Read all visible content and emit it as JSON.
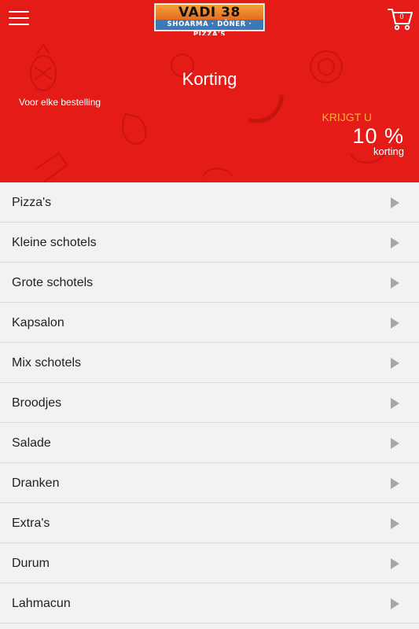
{
  "header": {
    "menu_icon": "hamburger-menu-icon",
    "logo": {
      "name": "VADI 38",
      "subtitle": "SHOARMA · DÖNER · PIZZA'S"
    },
    "cart_icon": "shopping-cart-icon",
    "cart_count": "0"
  },
  "banner": {
    "title": "Korting",
    "subtitle": "Voor elke bestelling",
    "krijgt": "KRIJGT U",
    "percentage": "10 %",
    "korting": "korting"
  },
  "menu": {
    "items": [
      {
        "label": "Pizza's"
      },
      {
        "label": "Kleine schotels"
      },
      {
        "label": "Grote schotels"
      },
      {
        "label": "Kapsalon"
      },
      {
        "label": "Mix schotels"
      },
      {
        "label": "Broodjes"
      },
      {
        "label": "Salade"
      },
      {
        "label": "Dranken"
      },
      {
        "label": "Extra's"
      },
      {
        "label": "Durum"
      },
      {
        "label": "Lahmacun"
      }
    ]
  },
  "colors": {
    "brand_red": "#e41b17",
    "accent_yellow": "#f6b731",
    "list_bg": "#f2f2f2",
    "chevron": "#a7a7a7"
  }
}
